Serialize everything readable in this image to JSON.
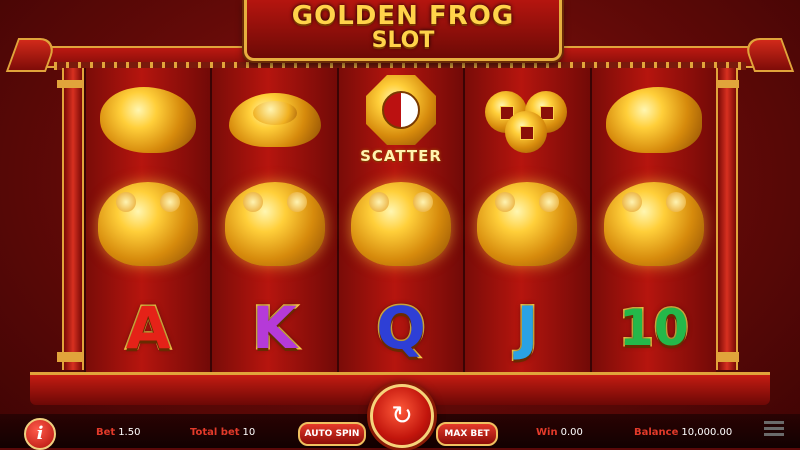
{
  "title": {
    "line1": "GOLDEN FROG",
    "line2": "SLOT"
  },
  "reels": [
    {
      "symbols": [
        "carp",
        "frog",
        "A"
      ]
    },
    {
      "symbols": [
        "gold-ingot",
        "frog",
        "K"
      ]
    },
    {
      "symbols": [
        "scatter",
        "frog",
        "Q"
      ]
    },
    {
      "symbols": [
        "coins",
        "frog",
        "J"
      ]
    },
    {
      "symbols": [
        "dragon-turtle",
        "frog",
        "10"
      ]
    }
  ],
  "scatter_label": "SCATTER",
  "letters": {
    "A": "A",
    "K": "K",
    "Q": "Q",
    "J": "J",
    "ten": "10"
  },
  "letter_colors": {
    "A": "#e52218",
    "K": "#b53ad8",
    "Q": "#2e3fd6",
    "J": "#2aa2e4",
    "ten": "#24b84a"
  },
  "hud": {
    "bet_label": "Bet",
    "bet_value": "1.50",
    "total_bet_label": "Total bet",
    "total_bet_value": "10",
    "auto_spin": "AUTO SPIN",
    "max_bet": "MAX BET",
    "win_label": "Win",
    "win_value": "0.00",
    "balance_label": "Balance",
    "balance_value": "10,000.00"
  },
  "icons": {
    "info": "i",
    "spin": "↻",
    "menu": "menu-icon"
  },
  "colors": {
    "gold": "#e1a43b",
    "red": "#b6150e",
    "hud_label": "#e23a2a"
  }
}
